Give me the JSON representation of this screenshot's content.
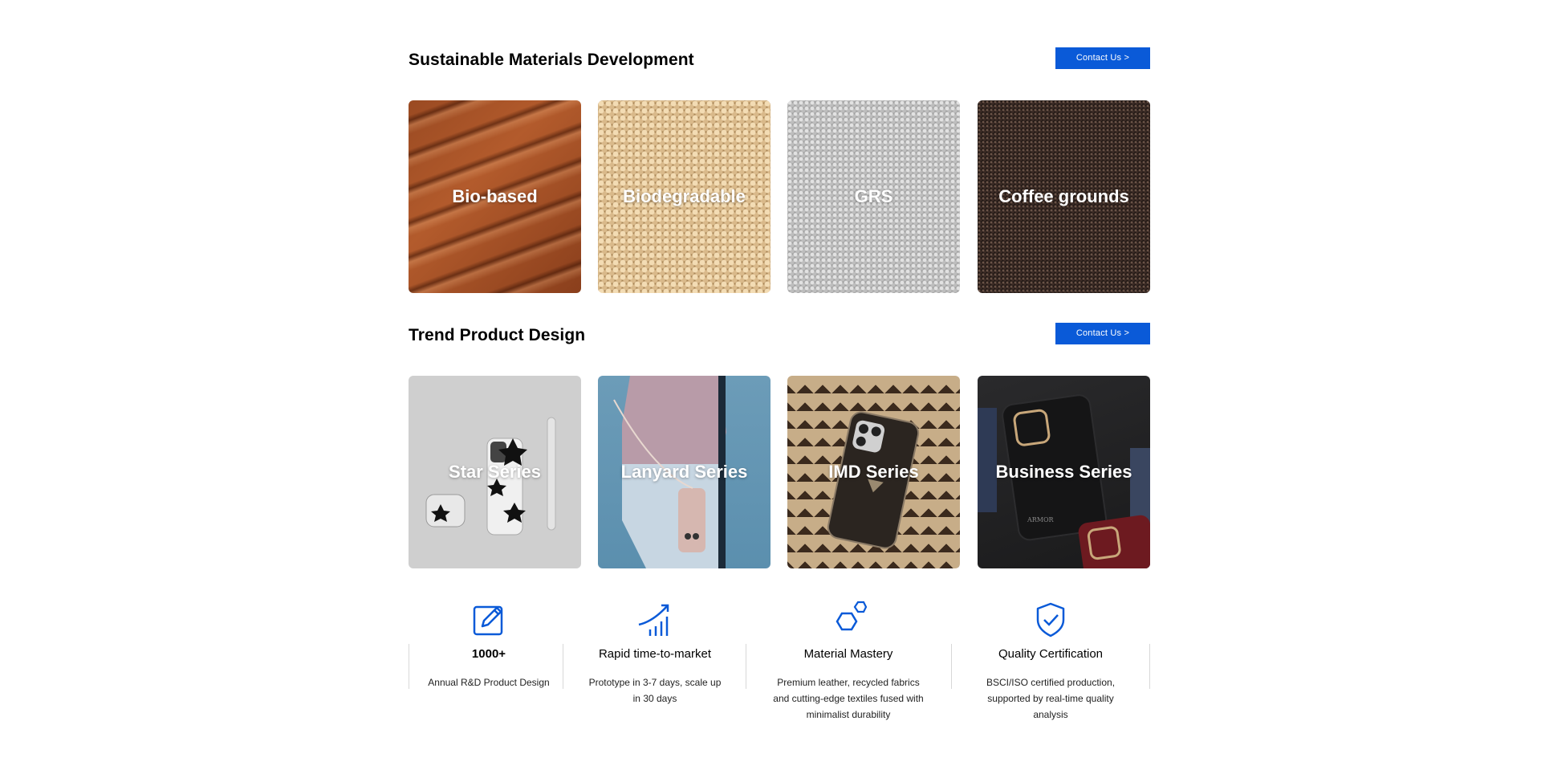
{
  "sections": [
    {
      "title": "Sustainable Materials Development",
      "cta": "Contact Us >",
      "cards": [
        "Bio-based",
        "Biodegradable",
        "GRS",
        "Coffee grounds"
      ]
    },
    {
      "title": "Trend Product Design",
      "cta": "Contact Us >",
      "cards": [
        "Star Series",
        "Lanyard Series",
        "IMD Series",
        "Business Series"
      ]
    }
  ],
  "features": [
    {
      "icon": "edit-document-icon",
      "title": "1000+",
      "desc": "Annual R&D Product Design"
    },
    {
      "icon": "growth-chart-icon",
      "title": "Rapid time-to-market",
      "desc": "Prototype in 3-7 days, scale up in 30 days"
    },
    {
      "icon": "hexagons-icon",
      "title": "Material Mastery",
      "desc": "Premium leather, recycled fabrics and cutting-edge textiles fused with minimalist durability"
    },
    {
      "icon": "shield-check-icon",
      "title": "Quality Certification",
      "desc": "BSCI/ISO certified production, supported by real-time quality analysis"
    }
  ],
  "colors": {
    "accent": "#0a5ad8",
    "text": "#000000"
  },
  "brand_mark": "ARMOR"
}
